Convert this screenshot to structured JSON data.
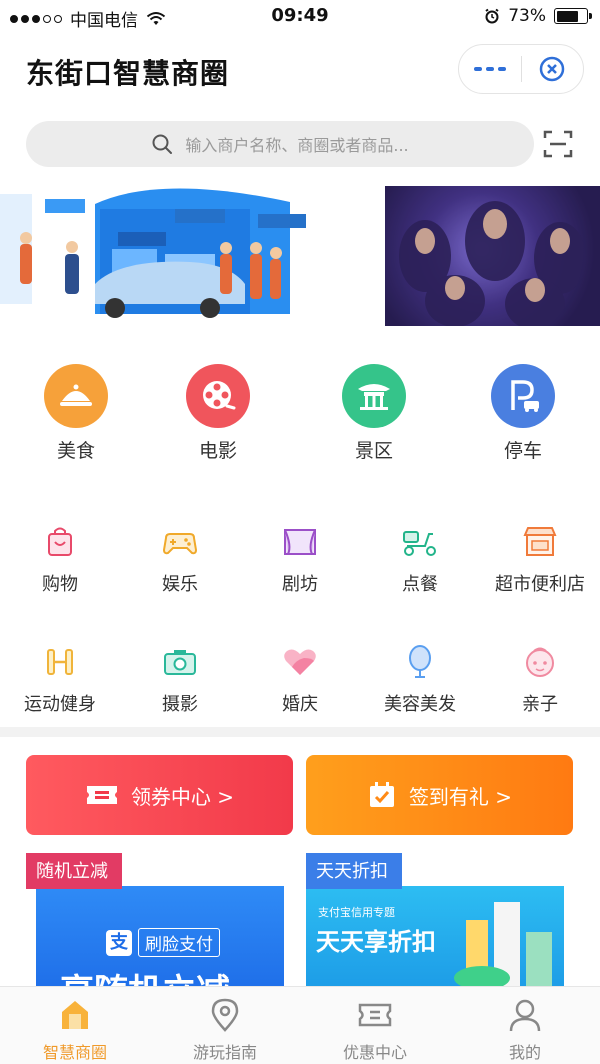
{
  "status_bar": {
    "carrier": "中国电信",
    "time": "09:49",
    "battery": "73%",
    "battery_level": 0.73
  },
  "header": {
    "title": "东街口智慧商圈"
  },
  "search": {
    "placeholder": "输入商户名称、商圈或者商品..."
  },
  "main_categories": [
    {
      "label": "美食",
      "icon": "cloche-icon",
      "color": "#f6a13a"
    },
    {
      "label": "电影",
      "icon": "film-reel-icon",
      "color": "#f0555c"
    },
    {
      "label": "景区",
      "icon": "pavilion-icon",
      "color": "#35c48a"
    },
    {
      "label": "停车",
      "icon": "parking-icon",
      "color": "#4a7fe0"
    }
  ],
  "sub_categories_row1": [
    {
      "label": "购物",
      "icon": "shopping-bag-icon",
      "color": "#e84a6a"
    },
    {
      "label": "娱乐",
      "icon": "gamepad-icon",
      "color": "#f0a92a"
    },
    {
      "label": "剧坊",
      "icon": "stage-icon",
      "color": "#9b4fc8"
    },
    {
      "label": "点餐",
      "icon": "scooter-icon",
      "color": "#22b48a"
    },
    {
      "label": "超市便利店",
      "icon": "store-icon",
      "color": "#f07a3a"
    }
  ],
  "sub_categories_row2": [
    {
      "label": "运动健身",
      "icon": "dumbbell-icon",
      "color": "#f0b43a"
    },
    {
      "label": "摄影",
      "icon": "camera-icon",
      "color": "#2ab89a"
    },
    {
      "label": "婚庆",
      "icon": "heart-icon",
      "color": "#f0608a"
    },
    {
      "label": "美容美发",
      "icon": "mirror-icon",
      "color": "#5a9ff0"
    },
    {
      "label": "亲子",
      "icon": "baby-icon",
      "color": "#f08aa0"
    }
  ],
  "promos": {
    "coupon": "领券中心 >",
    "checkin": "签到有礼 >"
  },
  "cards": {
    "card1_tag": "随机立减",
    "card1_brand": "刷脸支付",
    "card1_headline": "享随机立减",
    "card2_tag": "天天折扣",
    "card2_top": "支付宝信用专题",
    "card2_headline": "天天享折扣"
  },
  "tabbar": [
    {
      "label": "智慧商圈",
      "icon": "home-icon",
      "active": true
    },
    {
      "label": "游玩指南",
      "icon": "location-pin-icon",
      "active": false
    },
    {
      "label": "优惠中心",
      "icon": "ticket-icon",
      "active": false
    },
    {
      "label": "我的",
      "icon": "user-icon",
      "active": false
    }
  ]
}
